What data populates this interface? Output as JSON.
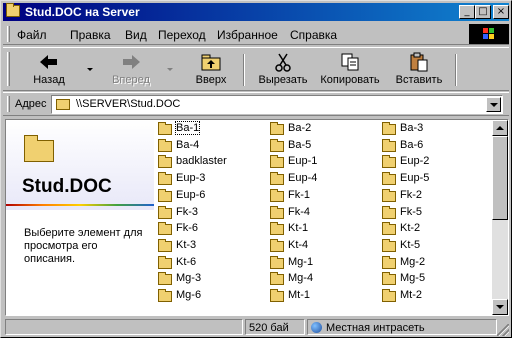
{
  "window": {
    "title": "Stud.DOC на Server",
    "minimize_glyph": "_",
    "maximize_glyph": "□",
    "close_glyph": "×"
  },
  "menu": [
    "Файл",
    "Правка",
    "Вид",
    "Переход",
    "Избранное",
    "Справка"
  ],
  "toolbar": {
    "back": "Назад",
    "forward": "Вперед",
    "up": "Вверх",
    "cut": "Вырезать",
    "copy": "Копировать",
    "paste": "Вставить"
  },
  "address": {
    "label": "Адрес",
    "value": "\\\\SERVER\\Stud.DOC"
  },
  "webview": {
    "folder_name": "Stud.DOC",
    "description": "Выберите элемент для просмотра его описания."
  },
  "files": [
    "Ba-1",
    "Ba-2",
    "Ba-3",
    "Ba-4",
    "Ba-5",
    "Ba-6",
    "badklaster",
    "Eup-1",
    "Eup-2",
    "Eup-3",
    "Eup-4",
    "Eup-5",
    "Eup-6",
    "Fk-1",
    "Fk-2",
    "Fk-3",
    "Fk-4",
    "Fk-5",
    "Fk-6",
    "Kt-1",
    "Kt-2",
    "Kt-3",
    "Kt-4",
    "Kt-5",
    "Kt-6",
    "Mg-1",
    "Mg-2",
    "Mg-3",
    "Mg-4",
    "Mg-5",
    "Mg-6",
    "Mt-1",
    "Mt-2"
  ],
  "selected_file": "Ba-1",
  "status": {
    "size": "520 бай",
    "zone": "Местная интрасеть"
  },
  "colors": {
    "title_start": "#000080",
    "title_end": "#1084d0",
    "face": "#c0c0c0",
    "folder": "#f0d070"
  }
}
